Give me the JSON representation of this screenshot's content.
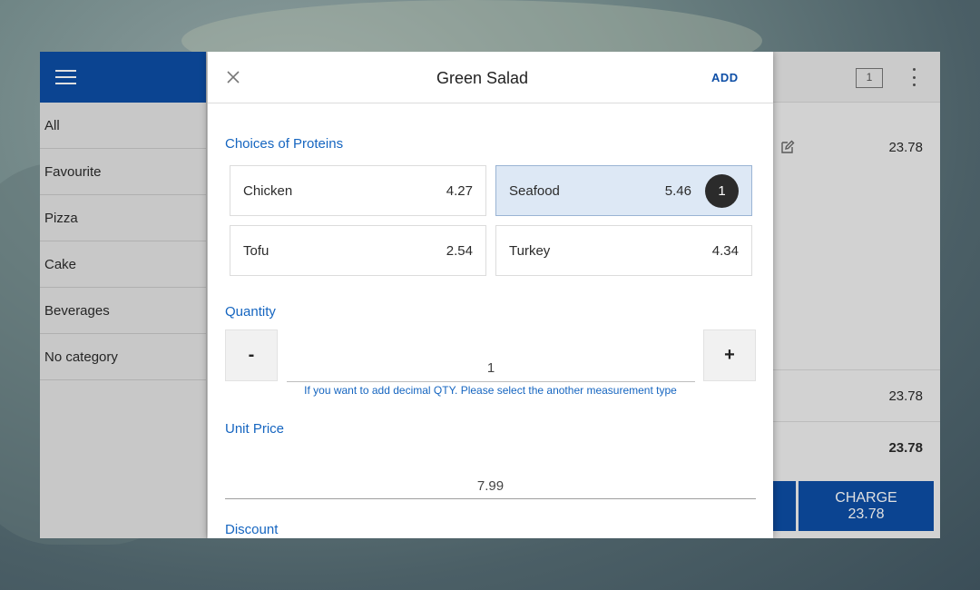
{
  "menu": {
    "categories": [
      {
        "label": "All"
      },
      {
        "label": "Favourite"
      },
      {
        "label": "Pizza"
      },
      {
        "label": "Cake"
      },
      {
        "label": "Beverages"
      },
      {
        "label": "No category"
      }
    ]
  },
  "cart": {
    "ticket_count": "1",
    "item_price": "23.78",
    "subtotal": "23.78",
    "total": "23.78",
    "charge_label": "CHARGE",
    "charge_amount": "23.78"
  },
  "dialog": {
    "title": "Green Salad",
    "add_label": "ADD",
    "proteins_label": "Choices of Proteins",
    "options": [
      {
        "name": "Chicken",
        "price": "4.27",
        "selected": false
      },
      {
        "name": "Seafood",
        "price": "5.46",
        "selected": true,
        "count": "1"
      },
      {
        "name": "Tofu",
        "price": "2.54",
        "selected": false
      },
      {
        "name": "Turkey",
        "price": "4.34",
        "selected": false
      }
    ],
    "quantity_label": "Quantity",
    "minus_label": "-",
    "plus_label": "+",
    "quantity_value": "1",
    "quantity_hint": "If you want to add decimal QTY. Please select the another measurement type",
    "unit_price_label": "Unit Price",
    "unit_price_value": "7.99",
    "discount_label": "Discount"
  },
  "colors": {
    "primary": "#0d4ea6",
    "accent_text": "#1565c0",
    "selected_option_bg": "#dde8f5"
  },
  "icons": [
    "hamburger-icon",
    "ticket-icon",
    "more-vert-icon",
    "edit-icon",
    "close-icon"
  ]
}
